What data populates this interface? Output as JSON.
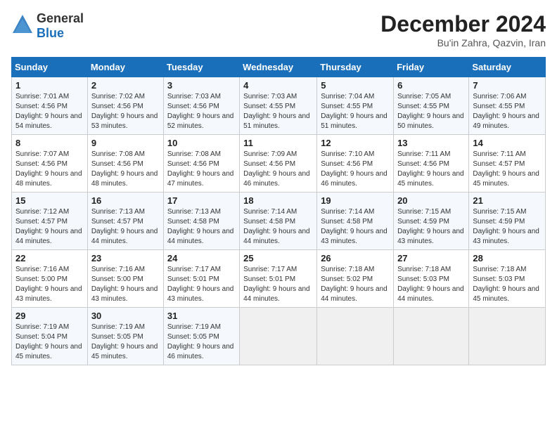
{
  "logo": {
    "general": "General",
    "blue": "Blue"
  },
  "header": {
    "month": "December 2024",
    "location": "Bu'in Zahra, Qazvin, Iran"
  },
  "weekdays": [
    "Sunday",
    "Monday",
    "Tuesday",
    "Wednesday",
    "Thursday",
    "Friday",
    "Saturday"
  ],
  "weeks": [
    [
      {
        "day": "1",
        "sunrise": "7:01 AM",
        "sunset": "4:56 PM",
        "daylight": "9 hours and 54 minutes."
      },
      {
        "day": "2",
        "sunrise": "7:02 AM",
        "sunset": "4:56 PM",
        "daylight": "9 hours and 53 minutes."
      },
      {
        "day": "3",
        "sunrise": "7:03 AM",
        "sunset": "4:56 PM",
        "daylight": "9 hours and 52 minutes."
      },
      {
        "day": "4",
        "sunrise": "7:03 AM",
        "sunset": "4:55 PM",
        "daylight": "9 hours and 51 minutes."
      },
      {
        "day": "5",
        "sunrise": "7:04 AM",
        "sunset": "4:55 PM",
        "daylight": "9 hours and 51 minutes."
      },
      {
        "day": "6",
        "sunrise": "7:05 AM",
        "sunset": "4:55 PM",
        "daylight": "9 hours and 50 minutes."
      },
      {
        "day": "7",
        "sunrise": "7:06 AM",
        "sunset": "4:55 PM",
        "daylight": "9 hours and 49 minutes."
      }
    ],
    [
      {
        "day": "8",
        "sunrise": "7:07 AM",
        "sunset": "4:56 PM",
        "daylight": "9 hours and 48 minutes."
      },
      {
        "day": "9",
        "sunrise": "7:08 AM",
        "sunset": "4:56 PM",
        "daylight": "9 hours and 48 minutes."
      },
      {
        "day": "10",
        "sunrise": "7:08 AM",
        "sunset": "4:56 PM",
        "daylight": "9 hours and 47 minutes."
      },
      {
        "day": "11",
        "sunrise": "7:09 AM",
        "sunset": "4:56 PM",
        "daylight": "9 hours and 46 minutes."
      },
      {
        "day": "12",
        "sunrise": "7:10 AM",
        "sunset": "4:56 PM",
        "daylight": "9 hours and 46 minutes."
      },
      {
        "day": "13",
        "sunrise": "7:11 AM",
        "sunset": "4:56 PM",
        "daylight": "9 hours and 45 minutes."
      },
      {
        "day": "14",
        "sunrise": "7:11 AM",
        "sunset": "4:57 PM",
        "daylight": "9 hours and 45 minutes."
      }
    ],
    [
      {
        "day": "15",
        "sunrise": "7:12 AM",
        "sunset": "4:57 PM",
        "daylight": "9 hours and 44 minutes."
      },
      {
        "day": "16",
        "sunrise": "7:13 AM",
        "sunset": "4:57 PM",
        "daylight": "9 hours and 44 minutes."
      },
      {
        "day": "17",
        "sunrise": "7:13 AM",
        "sunset": "4:58 PM",
        "daylight": "9 hours and 44 minutes."
      },
      {
        "day": "18",
        "sunrise": "7:14 AM",
        "sunset": "4:58 PM",
        "daylight": "9 hours and 44 minutes."
      },
      {
        "day": "19",
        "sunrise": "7:14 AM",
        "sunset": "4:58 PM",
        "daylight": "9 hours and 43 minutes."
      },
      {
        "day": "20",
        "sunrise": "7:15 AM",
        "sunset": "4:59 PM",
        "daylight": "9 hours and 43 minutes."
      },
      {
        "day": "21",
        "sunrise": "7:15 AM",
        "sunset": "4:59 PM",
        "daylight": "9 hours and 43 minutes."
      }
    ],
    [
      {
        "day": "22",
        "sunrise": "7:16 AM",
        "sunset": "5:00 PM",
        "daylight": "9 hours and 43 minutes."
      },
      {
        "day": "23",
        "sunrise": "7:16 AM",
        "sunset": "5:00 PM",
        "daylight": "9 hours and 43 minutes."
      },
      {
        "day": "24",
        "sunrise": "7:17 AM",
        "sunset": "5:01 PM",
        "daylight": "9 hours and 43 minutes."
      },
      {
        "day": "25",
        "sunrise": "7:17 AM",
        "sunset": "5:01 PM",
        "daylight": "9 hours and 44 minutes."
      },
      {
        "day": "26",
        "sunrise": "7:18 AM",
        "sunset": "5:02 PM",
        "daylight": "9 hours and 44 minutes."
      },
      {
        "day": "27",
        "sunrise": "7:18 AM",
        "sunset": "5:03 PM",
        "daylight": "9 hours and 44 minutes."
      },
      {
        "day": "28",
        "sunrise": "7:18 AM",
        "sunset": "5:03 PM",
        "daylight": "9 hours and 45 minutes."
      }
    ],
    [
      {
        "day": "29",
        "sunrise": "7:19 AM",
        "sunset": "5:04 PM",
        "daylight": "9 hours and 45 minutes."
      },
      {
        "day": "30",
        "sunrise": "7:19 AM",
        "sunset": "5:05 PM",
        "daylight": "9 hours and 45 minutes."
      },
      {
        "day": "31",
        "sunrise": "7:19 AM",
        "sunset": "5:05 PM",
        "daylight": "9 hours and 46 minutes."
      },
      null,
      null,
      null,
      null
    ]
  ],
  "labels": {
    "sunrise": "Sunrise:",
    "sunset": "Sunset:",
    "daylight": "Daylight:"
  }
}
